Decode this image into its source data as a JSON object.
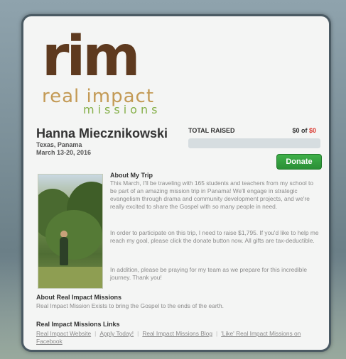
{
  "logo": {
    "rim": "rim",
    "real_impact": "real impact",
    "missions": "missions"
  },
  "profile": {
    "name": "Hanna Miecznikowski",
    "location": "Texas, Panama",
    "dates": "March 13-20, 2016"
  },
  "fundraising": {
    "total_label": "TOTAL RAISED",
    "raised": "$0",
    "of": "of",
    "goal": "$0",
    "progress_fraction": 0,
    "donate_label": "Donate"
  },
  "about_trip": {
    "heading": "About My Trip",
    "paragraphs": [
      "This March, I'll be traveling with 165 students and teachers from my school to be part of an amazing mission trip in Panama! We'll engage in strategic evangelism through drama and community development projects, and we're really excited to share the Gospel with so many people in need.",
      "In order to participate on this trip, I need to raise $1,795. If you'd like to help me reach my goal, please click the donate button now. All gifts are tax-deductible.",
      "In addition, please be praying for my team as we prepare for this incredible journey. Thank you!"
    ]
  },
  "about_rim": {
    "heading": "About Real Impact Missions",
    "text": "Real Impact Mission Exists to bring the Gospel to the ends of the earth."
  },
  "links": {
    "heading": "Real Impact Missions Links",
    "items": [
      "Real Impact Website",
      "Apply Today!",
      "Real Impact Missions Blog",
      "'Like' Real Impact Missions on Facebook"
    ]
  },
  "colors": {
    "brand_brown": "#5e3a1f",
    "brand_tan": "#c39a55",
    "brand_green": "#86b04a",
    "donate_green": "#2a8f35",
    "amount_red": "#d9342b"
  }
}
